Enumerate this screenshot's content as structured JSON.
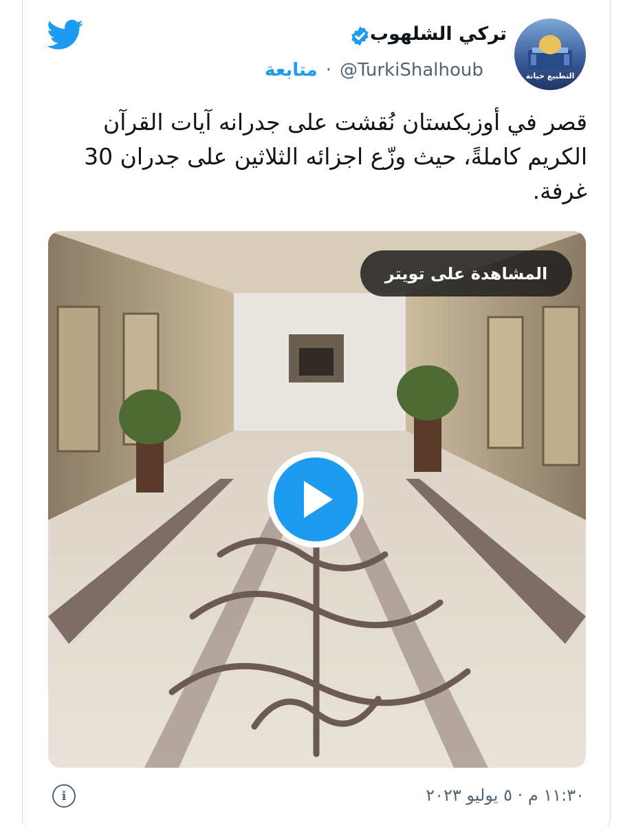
{
  "tweet": {
    "display_name": "تركي الشلهوب",
    "handle": "@TurkiShalhoub",
    "separator": "·",
    "follow_label": "متابعة",
    "avatar_caption": "التطبيع خيانة",
    "verified": true,
    "text": "قصر في أوزبكستان نُقشت على جدرانه آيات القرآن الكريم كاملةً، حيث وزّع اجزائه الثلاثين على جدران 30 غرفة.",
    "timestamp": "١١:٣٠ م · ٥ يوليو ٢٠٢٣"
  },
  "media": {
    "type": "video",
    "watch_label": "المشاهدة على تويتر"
  },
  "icons": {
    "logo": "twitter-bird-icon",
    "verified": "verified-badge-icon",
    "play": "play-icon",
    "info": "info-icon"
  },
  "colors": {
    "accent": "#1d9bf0",
    "text": "#0f1419",
    "secondary": "#536471",
    "border": "#d6dbe0"
  }
}
